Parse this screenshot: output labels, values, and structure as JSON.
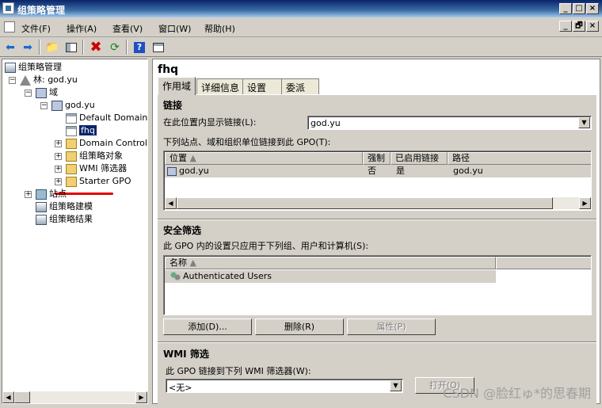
{
  "window": {
    "title": "组策略管理",
    "min": "_",
    "max": "□",
    "close": "×"
  },
  "menu": {
    "items": [
      "文件(F)",
      "操作(A)",
      "查看(V)",
      "窗口(W)",
      "帮助(H)"
    ],
    "mdi": [
      "_",
      "🗗",
      "×"
    ]
  },
  "toolbar": {
    "icons": [
      "back-arrow-icon",
      "forward-arrow-icon",
      "up-folder-icon",
      "show-tree-icon",
      "delete-icon",
      "refresh-icon",
      "help-icon",
      "properties-icon"
    ]
  },
  "tree": {
    "root": "组策略管理",
    "forest": "林: god.yu",
    "domains": "域",
    "domain": "god.yu",
    "default_domain": "Default Domain",
    "fhq": "fhq",
    "domain_controllers": "Domain Control",
    "gpo_objects": "组策略对象",
    "wmi_filters": "WMI 筛选器",
    "starter_gpo": "Starter GPO",
    "sites": "站点",
    "modeling": "组策略建模",
    "results": "组策略结果"
  },
  "detail": {
    "title": "fhq",
    "tabs": [
      "作用域",
      "详细信息",
      "设置",
      "委派"
    ],
    "links": {
      "heading": "链接",
      "location_label": "在此位置内显示链接(L):",
      "location_value": "god.yu",
      "list_label": "下列站点、域和组织单位链接到此 GPO(T):",
      "columns": [
        "位置",
        "强制",
        "已启用链接",
        "路径"
      ],
      "rows": [
        {
          "location": "god.yu",
          "enforced": "否",
          "enabled": "是",
          "path": "god.yu"
        }
      ]
    },
    "security": {
      "heading": "安全筛选",
      "description": "此 GPO 内的设置只应用于下列组、用户和计算机(S):",
      "columns": [
        "名称"
      ],
      "rows": [
        "Authenticated Users"
      ],
      "add": "添加(D)...",
      "remove": "删除(R)",
      "properties": "属性(P)"
    },
    "wmi": {
      "heading": "WMI 筛选",
      "description": "此 GPO 链接到下列 WMI 筛选器(W):",
      "value": "<无>",
      "open": "打开(O)"
    }
  },
  "watermark": "CSDN @脸红ゅ*的思春期"
}
